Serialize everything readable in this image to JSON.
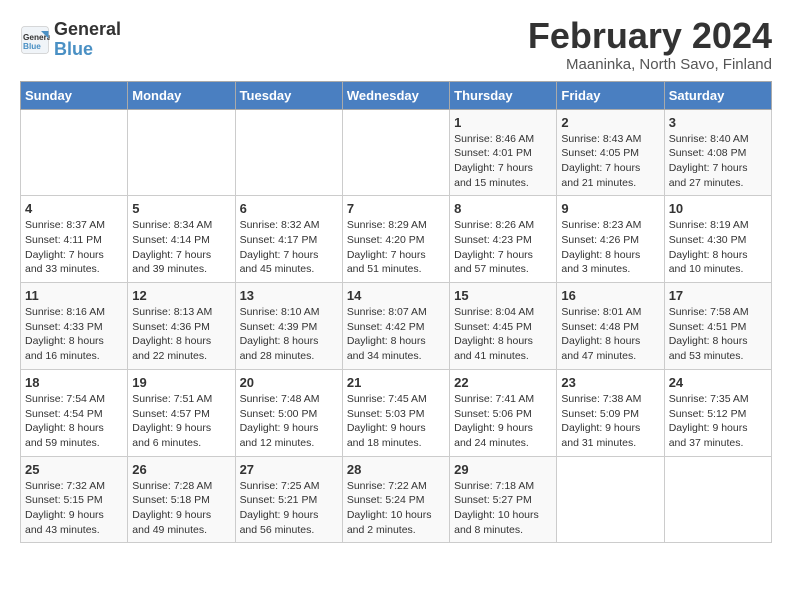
{
  "logo": {
    "line1": "General",
    "line2": "Blue"
  },
  "title": "February 2024",
  "subtitle": "Maaninka, North Savo, Finland",
  "days_header": [
    "Sunday",
    "Monday",
    "Tuesday",
    "Wednesday",
    "Thursday",
    "Friday",
    "Saturday"
  ],
  "weeks": [
    [
      {
        "day": "",
        "sunrise": "",
        "sunset": "",
        "daylight": ""
      },
      {
        "day": "",
        "sunrise": "",
        "sunset": "",
        "daylight": ""
      },
      {
        "day": "",
        "sunrise": "",
        "sunset": "",
        "daylight": ""
      },
      {
        "day": "",
        "sunrise": "",
        "sunset": "",
        "daylight": ""
      },
      {
        "day": "1",
        "sunrise": "Sunrise: 8:46 AM",
        "sunset": "Sunset: 4:01 PM",
        "daylight": "Daylight: 7 hours and 15 minutes."
      },
      {
        "day": "2",
        "sunrise": "Sunrise: 8:43 AM",
        "sunset": "Sunset: 4:05 PM",
        "daylight": "Daylight: 7 hours and 21 minutes."
      },
      {
        "day": "3",
        "sunrise": "Sunrise: 8:40 AM",
        "sunset": "Sunset: 4:08 PM",
        "daylight": "Daylight: 7 hours and 27 minutes."
      }
    ],
    [
      {
        "day": "4",
        "sunrise": "Sunrise: 8:37 AM",
        "sunset": "Sunset: 4:11 PM",
        "daylight": "Daylight: 7 hours and 33 minutes."
      },
      {
        "day": "5",
        "sunrise": "Sunrise: 8:34 AM",
        "sunset": "Sunset: 4:14 PM",
        "daylight": "Daylight: 7 hours and 39 minutes."
      },
      {
        "day": "6",
        "sunrise": "Sunrise: 8:32 AM",
        "sunset": "Sunset: 4:17 PM",
        "daylight": "Daylight: 7 hours and 45 minutes."
      },
      {
        "day": "7",
        "sunrise": "Sunrise: 8:29 AM",
        "sunset": "Sunset: 4:20 PM",
        "daylight": "Daylight: 7 hours and 51 minutes."
      },
      {
        "day": "8",
        "sunrise": "Sunrise: 8:26 AM",
        "sunset": "Sunset: 4:23 PM",
        "daylight": "Daylight: 7 hours and 57 minutes."
      },
      {
        "day": "9",
        "sunrise": "Sunrise: 8:23 AM",
        "sunset": "Sunset: 4:26 PM",
        "daylight": "Daylight: 8 hours and 3 minutes."
      },
      {
        "day": "10",
        "sunrise": "Sunrise: 8:19 AM",
        "sunset": "Sunset: 4:30 PM",
        "daylight": "Daylight: 8 hours and 10 minutes."
      }
    ],
    [
      {
        "day": "11",
        "sunrise": "Sunrise: 8:16 AM",
        "sunset": "Sunset: 4:33 PM",
        "daylight": "Daylight: 8 hours and 16 minutes."
      },
      {
        "day": "12",
        "sunrise": "Sunrise: 8:13 AM",
        "sunset": "Sunset: 4:36 PM",
        "daylight": "Daylight: 8 hours and 22 minutes."
      },
      {
        "day": "13",
        "sunrise": "Sunrise: 8:10 AM",
        "sunset": "Sunset: 4:39 PM",
        "daylight": "Daylight: 8 hours and 28 minutes."
      },
      {
        "day": "14",
        "sunrise": "Sunrise: 8:07 AM",
        "sunset": "Sunset: 4:42 PM",
        "daylight": "Daylight: 8 hours and 34 minutes."
      },
      {
        "day": "15",
        "sunrise": "Sunrise: 8:04 AM",
        "sunset": "Sunset: 4:45 PM",
        "daylight": "Daylight: 8 hours and 41 minutes."
      },
      {
        "day": "16",
        "sunrise": "Sunrise: 8:01 AM",
        "sunset": "Sunset: 4:48 PM",
        "daylight": "Daylight: 8 hours and 47 minutes."
      },
      {
        "day": "17",
        "sunrise": "Sunrise: 7:58 AM",
        "sunset": "Sunset: 4:51 PM",
        "daylight": "Daylight: 8 hours and 53 minutes."
      }
    ],
    [
      {
        "day": "18",
        "sunrise": "Sunrise: 7:54 AM",
        "sunset": "Sunset: 4:54 PM",
        "daylight": "Daylight: 8 hours and 59 minutes."
      },
      {
        "day": "19",
        "sunrise": "Sunrise: 7:51 AM",
        "sunset": "Sunset: 4:57 PM",
        "daylight": "Daylight: 9 hours and 6 minutes."
      },
      {
        "day": "20",
        "sunrise": "Sunrise: 7:48 AM",
        "sunset": "Sunset: 5:00 PM",
        "daylight": "Daylight: 9 hours and 12 minutes."
      },
      {
        "day": "21",
        "sunrise": "Sunrise: 7:45 AM",
        "sunset": "Sunset: 5:03 PM",
        "daylight": "Daylight: 9 hours and 18 minutes."
      },
      {
        "day": "22",
        "sunrise": "Sunrise: 7:41 AM",
        "sunset": "Sunset: 5:06 PM",
        "daylight": "Daylight: 9 hours and 24 minutes."
      },
      {
        "day": "23",
        "sunrise": "Sunrise: 7:38 AM",
        "sunset": "Sunset: 5:09 PM",
        "daylight": "Daylight: 9 hours and 31 minutes."
      },
      {
        "day": "24",
        "sunrise": "Sunrise: 7:35 AM",
        "sunset": "Sunset: 5:12 PM",
        "daylight": "Daylight: 9 hours and 37 minutes."
      }
    ],
    [
      {
        "day": "25",
        "sunrise": "Sunrise: 7:32 AM",
        "sunset": "Sunset: 5:15 PM",
        "daylight": "Daylight: 9 hours and 43 minutes."
      },
      {
        "day": "26",
        "sunrise": "Sunrise: 7:28 AM",
        "sunset": "Sunset: 5:18 PM",
        "daylight": "Daylight: 9 hours and 49 minutes."
      },
      {
        "day": "27",
        "sunrise": "Sunrise: 7:25 AM",
        "sunset": "Sunset: 5:21 PM",
        "daylight": "Daylight: 9 hours and 56 minutes."
      },
      {
        "day": "28",
        "sunrise": "Sunrise: 7:22 AM",
        "sunset": "Sunset: 5:24 PM",
        "daylight": "Daylight: 10 hours and 2 minutes."
      },
      {
        "day": "29",
        "sunrise": "Sunrise: 7:18 AM",
        "sunset": "Sunset: 5:27 PM",
        "daylight": "Daylight: 10 hours and 8 minutes."
      },
      {
        "day": "",
        "sunrise": "",
        "sunset": "",
        "daylight": ""
      },
      {
        "day": "",
        "sunrise": "",
        "sunset": "",
        "daylight": ""
      }
    ]
  ]
}
